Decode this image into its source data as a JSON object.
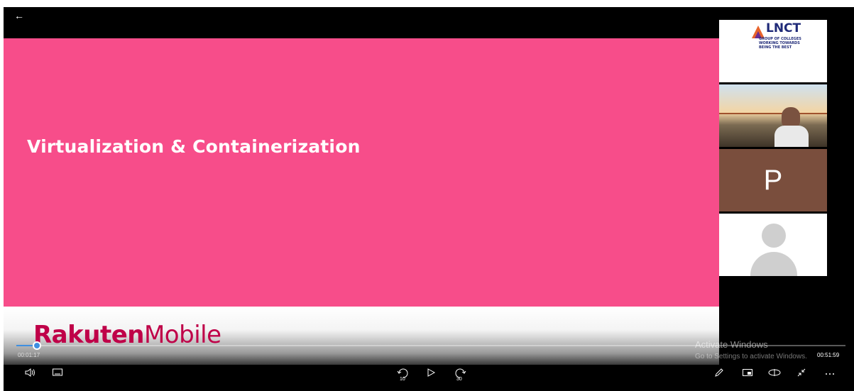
{
  "slide": {
    "title": "Virtualization & Containerization",
    "brand_bold": "Rakuten",
    "brand_light": "Mobile"
  },
  "participants": {
    "logo_name": "LNCT",
    "logo_tagline": "GROUP OF COLLEGES WORKING TOWARDS BEING THE BEST",
    "p_initial": "P"
  },
  "watermark": {
    "title": "Activate Windows",
    "subtitle": "Go to Settings to activate Windows."
  },
  "playback": {
    "current_time": "00:01:17",
    "total_time": "00:51:59",
    "progress": 0.025,
    "skip_back": "10",
    "skip_forward": "30"
  },
  "icons": {
    "back": "arrow-left-icon",
    "volume": "speaker-icon",
    "subtitles": "subtitles-icon",
    "skip_back": "rewind-10-icon",
    "play": "play-icon",
    "skip_forward": "forward-30-icon",
    "edit": "pencil-icon",
    "mini": "mini-view-icon",
    "vr": "360-icon",
    "fullscreen": "exit-fullscreen-icon",
    "more": "more-icon"
  },
  "colors": {
    "slide_bg": "#f74d8a",
    "brand": "#bf0048",
    "accent": "#3f8fe0"
  }
}
